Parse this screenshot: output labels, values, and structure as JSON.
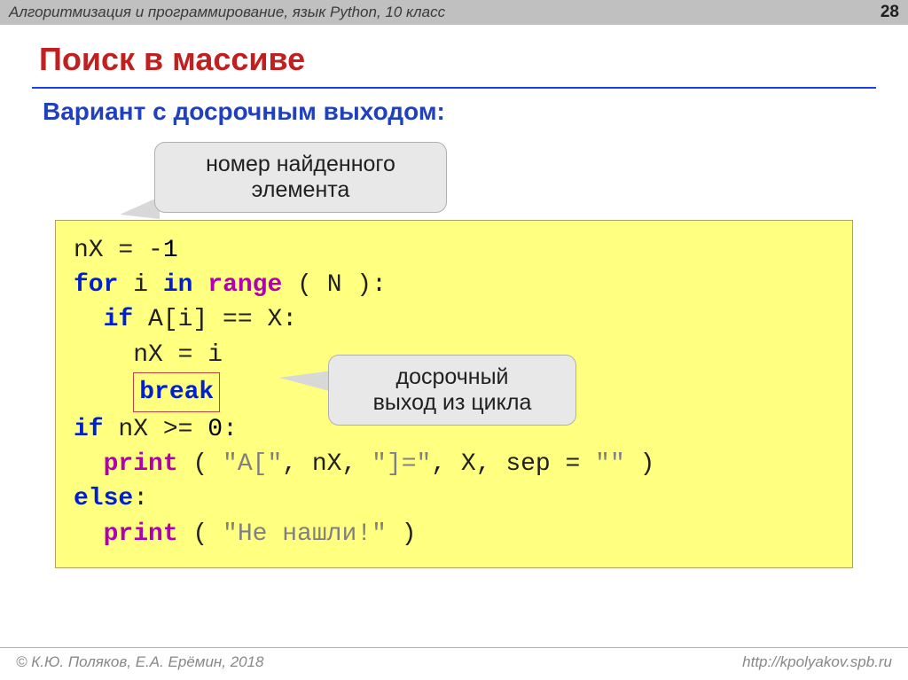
{
  "header": {
    "breadcrumb": "Алгоритмизация и программирование, язык Python, 10 класс",
    "page_number": "28"
  },
  "title": "Поиск в массиве",
  "subtitle": "Вариант с досрочным выходом:",
  "callout1_line1": "номер найденного",
  "callout1_line2": "элемента",
  "callout2_line1": "досрочный",
  "callout2_line2": "выход из цикла",
  "code": {
    "l1a": "nX",
    "l1b": "=",
    "l1c": "-",
    "l1d": "1",
    "l2a": "for",
    "l2b": " i ",
    "l2c": "in",
    "l2d": " ",
    "l2e": "range",
    "l2f": " ( N ):",
    "l3a": "  ",
    "l3b": "if",
    "l3c": " A[i]",
    "l3d": "==",
    "l3e": "X:",
    "l4a": "    nX",
    "l4b": "=",
    "l4c": "i",
    "l5a": "    ",
    "l5b": "break",
    "l6a": "if",
    "l6b": " nX",
    "l6c": ">=",
    "l6d": "0",
    "l6e": ":",
    "l7a": "  ",
    "l7b": "print",
    "l7c": " ( ",
    "l7d": "\"A[\"",
    "l7e": ", nX, ",
    "l7f": "\"]=\"",
    "l7g": ", X, sep",
    "l7h": "=",
    "l7i": "\"\"",
    "l7j": " )",
    "l8a": "else",
    "l8b": ":",
    "l9a": "  ",
    "l9b": "print",
    "l9c": " ( ",
    "l9d": "\"Не нашли!\"",
    "l9e": " )"
  },
  "footer": {
    "left": "© К.Ю. Поляков, Е.А. Ерёмин, 2018",
    "right": "http://kpolyakov.spb.ru"
  }
}
